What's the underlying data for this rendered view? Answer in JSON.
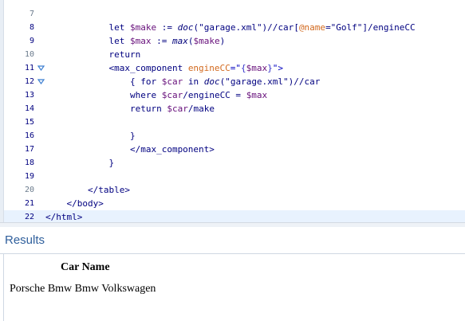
{
  "editor": {
    "lines": [
      {
        "num": "7",
        "tokens": []
      },
      {
        "num": "8",
        "tokens": [
          {
            "t": "            let ",
            "c": "c-kw"
          },
          {
            "t": "$make",
            "c": "c-var"
          },
          {
            "t": " := ",
            "c": "c-op"
          },
          {
            "t": "doc",
            "c": "c-fn"
          },
          {
            "t": "(\"garage.xml\")//",
            "c": "c-str"
          },
          {
            "t": "car",
            "c": "c-path"
          },
          {
            "t": "[",
            "c": "c-op"
          },
          {
            "t": "@name",
            "c": "c-attr"
          },
          {
            "t": "=\"Golf\"]/",
            "c": "c-str"
          },
          {
            "t": "engineCC",
            "c": "c-path"
          }
        ]
      },
      {
        "num": "9",
        "tokens": [
          {
            "t": "            let ",
            "c": "c-kw"
          },
          {
            "t": "$max",
            "c": "c-var"
          },
          {
            "t": " := ",
            "c": "c-op"
          },
          {
            "t": "max",
            "c": "c-fn"
          },
          {
            "t": "(",
            "c": "c-op"
          },
          {
            "t": "$make",
            "c": "c-var"
          },
          {
            "t": ")",
            "c": "c-op"
          }
        ]
      },
      {
        "num": "10",
        "tokens": [
          {
            "t": "            return",
            "c": "c-kw"
          }
        ]
      },
      {
        "num": "11",
        "fold": true,
        "tokens": [
          {
            "t": "            <max_component ",
            "c": "c-tag"
          },
          {
            "t": "engineCC",
            "c": "c-attrname"
          },
          {
            "t": "=\"",
            "c": "c-attrval"
          },
          {
            "t": "{",
            "c": "c-brace"
          },
          {
            "t": "$max",
            "c": "c-var"
          },
          {
            "t": "}",
            "c": "c-brace"
          },
          {
            "t": "\">",
            "c": "c-attrval"
          }
        ]
      },
      {
        "num": "12",
        "fold": true,
        "tokens": [
          {
            "t": "                { for ",
            "c": "c-kw"
          },
          {
            "t": "$car",
            "c": "c-var"
          },
          {
            "t": " in ",
            "c": "c-kw"
          },
          {
            "t": "doc",
            "c": "c-fn"
          },
          {
            "t": "(\"garage.xml\")//",
            "c": "c-str"
          },
          {
            "t": "car",
            "c": "c-path"
          }
        ]
      },
      {
        "num": "13",
        "tokens": [
          {
            "t": "                where ",
            "c": "c-kw"
          },
          {
            "t": "$car",
            "c": "c-var"
          },
          {
            "t": "/",
            "c": "c-op"
          },
          {
            "t": "engineCC",
            "c": "c-path"
          },
          {
            "t": " = ",
            "c": "c-op"
          },
          {
            "t": "$max",
            "c": "c-var"
          }
        ]
      },
      {
        "num": "14",
        "tokens": [
          {
            "t": "                return ",
            "c": "c-kw"
          },
          {
            "t": "$car",
            "c": "c-var"
          },
          {
            "t": "/",
            "c": "c-op"
          },
          {
            "t": "make",
            "c": "c-path"
          }
        ]
      },
      {
        "num": "15",
        "tokens": []
      },
      {
        "num": "16",
        "tokens": [
          {
            "t": "                }",
            "c": "c-kw"
          }
        ]
      },
      {
        "num": "17",
        "tokens": [
          {
            "t": "                </max_component>",
            "c": "c-tag"
          }
        ]
      },
      {
        "num": "18",
        "tokens": [
          {
            "t": "            }",
            "c": "c-kw"
          }
        ]
      },
      {
        "num": "19",
        "tokens": []
      },
      {
        "num": "20",
        "tokens": [
          {
            "t": "        </table>",
            "c": "c-tag"
          }
        ]
      },
      {
        "num": "21",
        "tokens": [
          {
            "t": "    </body>",
            "c": "c-tag"
          }
        ]
      },
      {
        "num": "22",
        "current": true,
        "tokens": [
          {
            "t": "</html>",
            "c": "c-tag"
          }
        ]
      }
    ],
    "colors": {
      "line_number": "#000080",
      "line_number_dim": "#6a7a8c",
      "fold_marker": "#3c7fd1",
      "current_line": "#e8f2fe"
    }
  },
  "results": {
    "title": "Results",
    "column_header": "Car Name",
    "row_text": "Porsche Bmw Bmw Volkswagen"
  }
}
